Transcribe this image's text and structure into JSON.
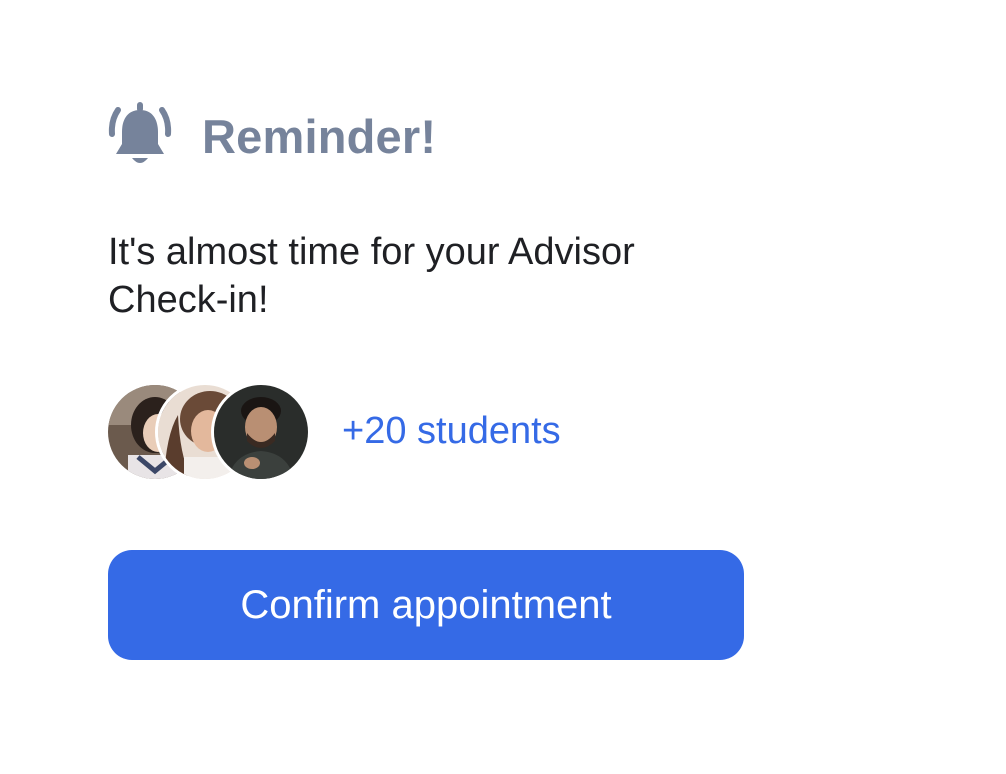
{
  "reminder": {
    "icon": "bell-ringing-icon",
    "title": "Reminder!",
    "message": "It's almost time for your Advisor Check-in!"
  },
  "attendees": {
    "avatars": [
      {
        "name": "student-avatar-1",
        "icon": "avatar"
      },
      {
        "name": "student-avatar-2",
        "icon": "avatar"
      },
      {
        "name": "student-avatar-3",
        "icon": "avatar"
      }
    ],
    "count_label": "+20 students"
  },
  "actions": {
    "confirm_label": "Confirm appointment"
  },
  "colors": {
    "accent": "#356ae6",
    "title_gray": "#76839b",
    "text_dark": "#1f2024"
  }
}
